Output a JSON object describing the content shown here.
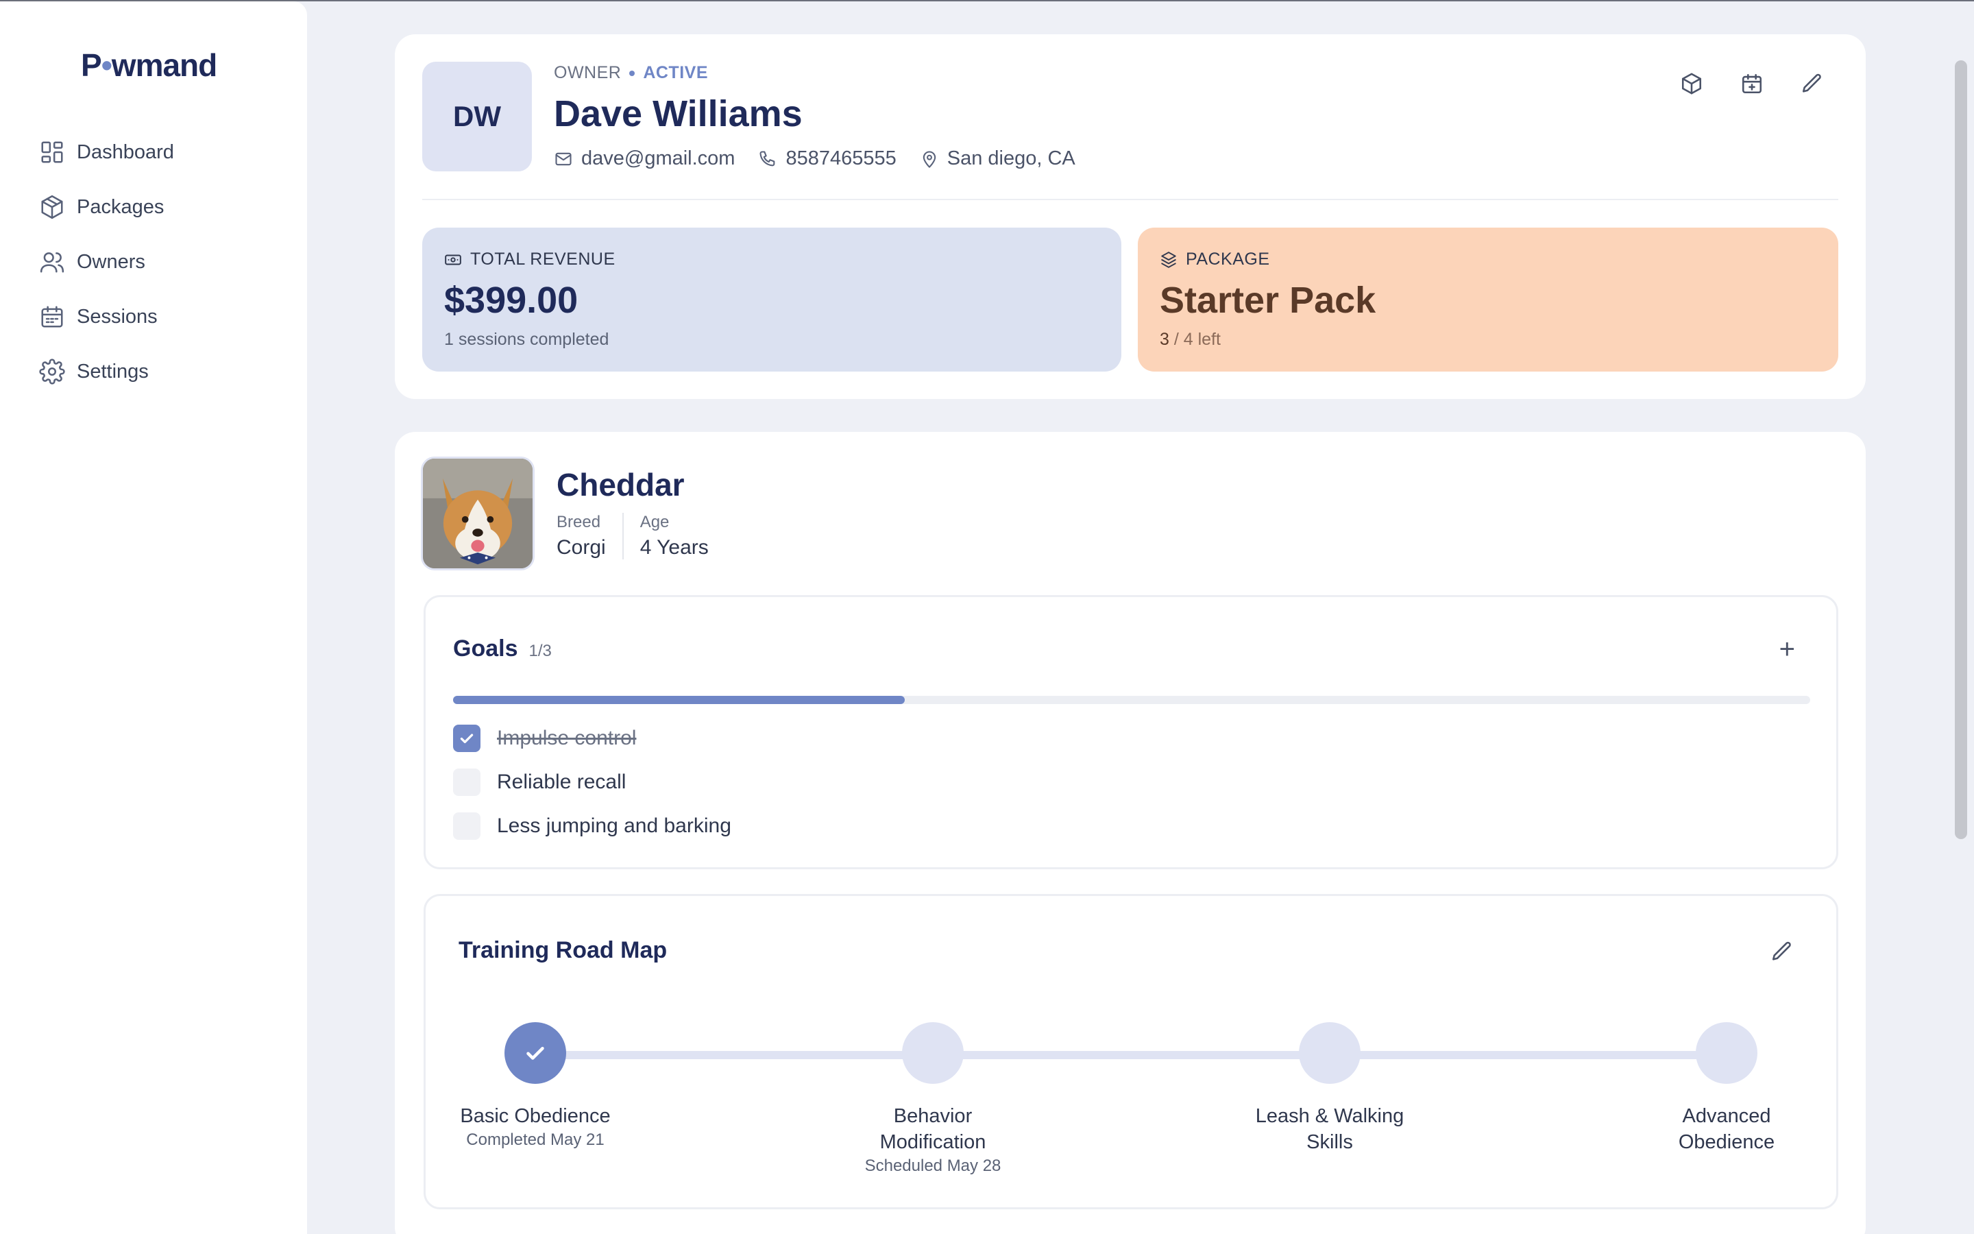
{
  "brand": {
    "name_prefix": "P",
    "name_paw": "🐾",
    "name_suffix": "wmand"
  },
  "sidebar": {
    "items": [
      {
        "label": "Dashboard",
        "icon": "dashboard-icon"
      },
      {
        "label": "Packages",
        "icon": "package-icon"
      },
      {
        "label": "Owners",
        "icon": "users-icon"
      },
      {
        "label": "Sessions",
        "icon": "calendar-icon"
      },
      {
        "label": "Settings",
        "icon": "gear-icon"
      }
    ]
  },
  "owner": {
    "initials": "DW",
    "role": "OWNER",
    "status": "ACTIVE",
    "name": "Dave Williams",
    "email": "dave@gmail.com",
    "phone": "8587465555",
    "location": "San diego, CA"
  },
  "stats": {
    "revenue": {
      "label": "TOTAL REVENUE",
      "value": "$399.00",
      "sub": "1 sessions completed"
    },
    "package": {
      "label": "PACKAGE",
      "value": "Starter Pack",
      "remaining": "3",
      "sub_rest": " / 4 left"
    }
  },
  "pet": {
    "name": "Cheddar",
    "breed_label": "Breed",
    "breed": "Corgi",
    "age_label": "Age",
    "age": "4 Years"
  },
  "goals": {
    "title": "Goals",
    "count": "1/3",
    "add": "+",
    "progress_fraction": 0.333,
    "items": [
      {
        "label": "Impulse control",
        "done": true
      },
      {
        "label": "Reliable recall",
        "done": false
      },
      {
        "label": "Less jumping and barking",
        "done": false
      }
    ]
  },
  "roadmap": {
    "title": "Training Road Map",
    "steps": [
      {
        "name": "Basic Obedience",
        "date": "Completed May 21",
        "done": true
      },
      {
        "name": "Behavior Modification",
        "date": "Scheduled May 28",
        "done": false
      },
      {
        "name": "Leash & Walking Skills",
        "date": "",
        "done": false
      },
      {
        "name": "Advanced Obedience",
        "date": "",
        "done": false
      }
    ]
  },
  "colors": {
    "accent": "#6f86c6",
    "brand": "#1f2a5a",
    "revenue_bg": "#dbe1f1",
    "package_bg": "#fcd4b9"
  }
}
